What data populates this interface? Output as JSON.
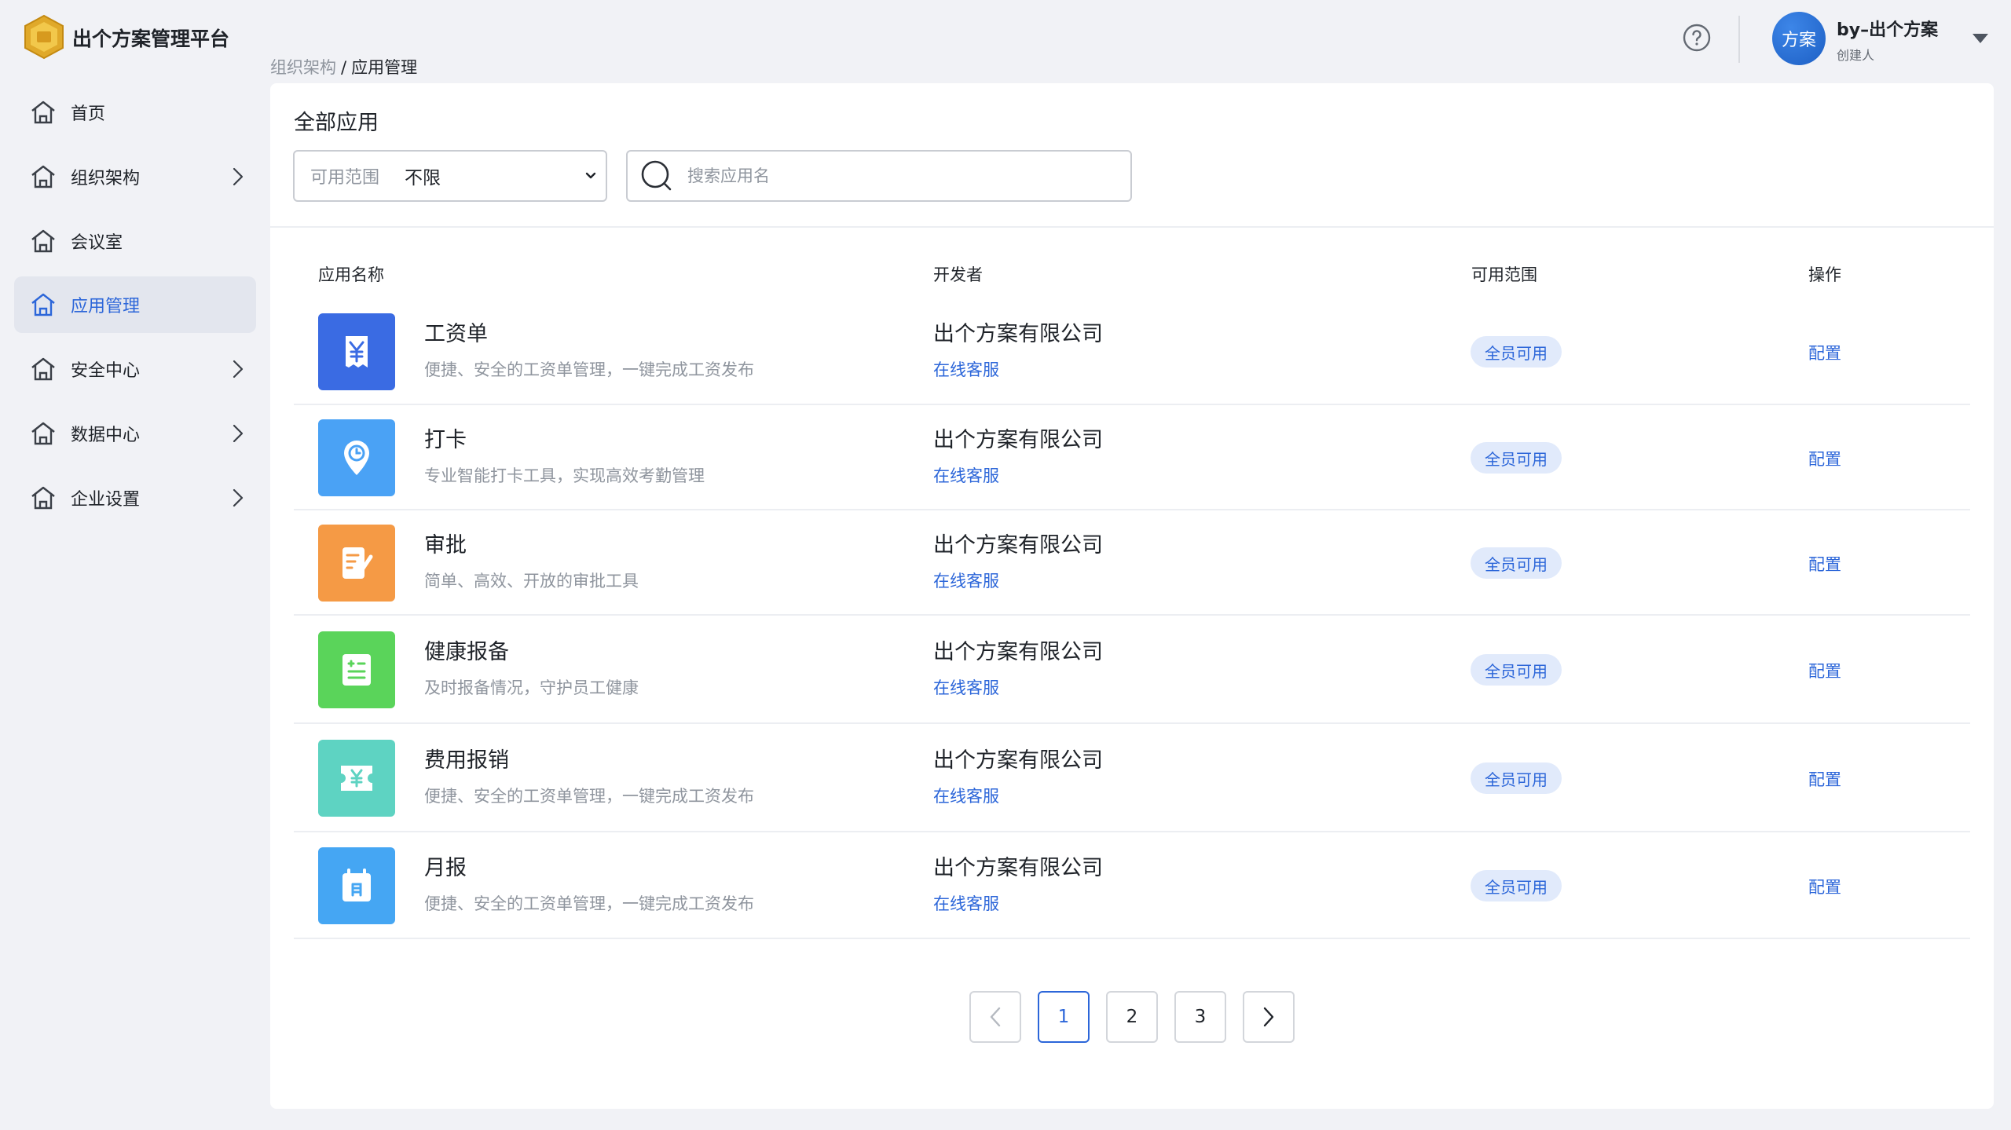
{
  "app": {
    "brand": "出个方案管理平台"
  },
  "header": {
    "user_initials": "方案",
    "user_name": "by–出个方案",
    "user_role": "创建人"
  },
  "sidebar": {
    "items": [
      {
        "label": "首页",
        "has_children": false,
        "active": false
      },
      {
        "label": "组织架构",
        "has_children": true,
        "active": false
      },
      {
        "label": "会议室",
        "has_children": false,
        "active": false
      },
      {
        "label": "应用管理",
        "has_children": false,
        "active": true
      },
      {
        "label": "安全中心",
        "has_children": true,
        "active": false
      },
      {
        "label": "数据中心",
        "has_children": true,
        "active": false
      },
      {
        "label": "企业设置",
        "has_children": true,
        "active": false
      }
    ]
  },
  "breadcrumb": {
    "parent": "组织架构",
    "separator": "/",
    "current": "应用管理"
  },
  "main": {
    "title": "全部应用",
    "filter": {
      "label": "可用范围",
      "value": "不限"
    },
    "search": {
      "placeholder": "搜索应用名",
      "value": ""
    },
    "table": {
      "columns": [
        "应用名称",
        "开发者",
        "可用范围",
        "操作"
      ],
      "rows": [
        {
          "name": "工资单",
          "desc": "便捷、安全的工资单管理，一键完成工资发布",
          "developer": "出个方案有限公司",
          "support": "在线客服",
          "scope": "全员可用",
          "action": "配置",
          "icon": "payroll-icon",
          "color": "#3a6be3"
        },
        {
          "name": "打卡",
          "desc": "专业智能打卡工具，实现高效考勤管理",
          "developer": "出个方案有限公司",
          "support": "在线客服",
          "scope": "全员可用",
          "action": "配置",
          "icon": "clock-in-icon",
          "color": "#4aa2f5"
        },
        {
          "name": "审批",
          "desc": "简单、高效、开放的审批工具",
          "developer": "出个方案有限公司",
          "support": "在线客服",
          "scope": "全员可用",
          "action": "配置",
          "icon": "approval-icon",
          "color": "#f59a45"
        },
        {
          "name": "健康报备",
          "desc": "及时报备情况，守护员工健康",
          "developer": "出个方案有限公司",
          "support": "在线客服",
          "scope": "全员可用",
          "action": "配置",
          "icon": "health-report-icon",
          "color": "#5ad45a"
        },
        {
          "name": "费用报销",
          "desc": "便捷、安全的工资单管理，一键完成工资发布",
          "developer": "出个方案有限公司",
          "support": "在线客服",
          "scope": "全员可用",
          "action": "配置",
          "icon": "expense-icon",
          "color": "#5ed3c2"
        },
        {
          "name": "月报",
          "desc": "便捷、安全的工资单管理，一键完成工资发布",
          "developer": "出个方案有限公司",
          "support": "在线客服",
          "scope": "全员可用",
          "action": "配置",
          "icon": "monthly-report-icon",
          "color": "#45a6f3"
        }
      ]
    },
    "pagination": {
      "pages": [
        "1",
        "2",
        "3"
      ],
      "current": "1"
    }
  },
  "colors": {
    "accent": "#2c66d9",
    "badge_bg": "#e1eafb",
    "page_bg": "#f1f2f6"
  }
}
